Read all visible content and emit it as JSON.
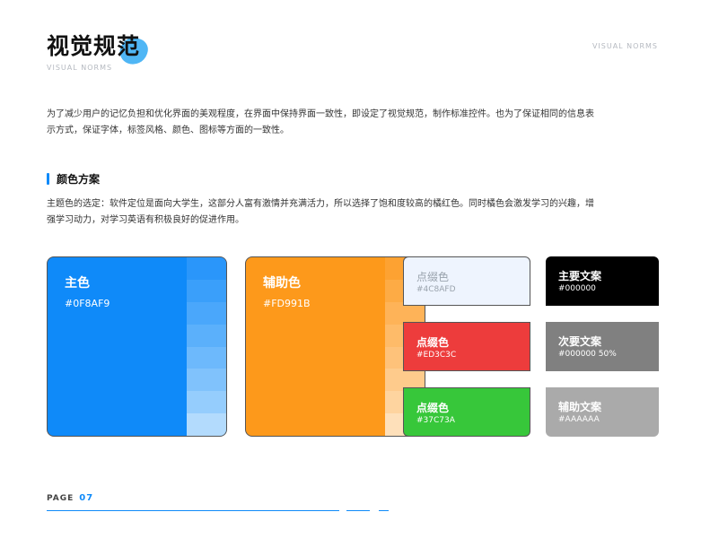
{
  "header": {
    "title": "视觉规范",
    "subtitle": "VISUAL NORMS",
    "corner": "VISUAL NORMS"
  },
  "intro": "为了减少用户的记忆负担和优化界面的美观程度，在界面中保持界面一致性，即设定了视觉规范，制作标准控件。也为了保证相同的信息表示方式，保证字体，标签风格、颜色、图标等方面的一致性。",
  "section": {
    "title": "颜色方案",
    "description": "主题色的选定：软件定位是面向大学生，这部分人富有激情并充满活力，所以选择了饱和度较高的橘红色。同时橘色会激发学习的兴趣，增强学习动力，对学习英语有积极良好的促进作用。"
  },
  "colors": {
    "primary": {
      "name": "主色",
      "hex": "#0F8AF9",
      "color": "#0F8AF9"
    },
    "secondary": {
      "name": "辅助色",
      "hex": "#FD991B",
      "color": "#FD991B"
    },
    "accent1": {
      "name": "点缀色",
      "hex": "#4C8AFD",
      "color": "#EEF4FE",
      "text_color": "#9aa3ad"
    },
    "accent2": {
      "name": "点缀色",
      "hex": "#ED3C3C",
      "color": "#ED3C3C"
    },
    "accent3": {
      "name": "点缀色",
      "hex": "#37C73A",
      "color": "#37C73A"
    },
    "text_primary": {
      "name": "主要文案",
      "hex": "#000000",
      "color": "#000000"
    },
    "text_secondary": {
      "name": "次要文案",
      "hex": "#000000  50%",
      "color": "#808080"
    },
    "text_aux": {
      "name": "辅助文案",
      "hex": "#AAAAAA",
      "color": "#AAAAAA"
    }
  },
  "primary_tints": [
    "#2a96fa",
    "#3a9ffa",
    "#4aa7fb",
    "#5bb0fb",
    "#6db9fc",
    "#80c2fc",
    "#95cdfd",
    "#b3dbfd"
  ],
  "secondary_tints": [
    "#fda232",
    "#fdab45",
    "#feb358",
    "#febb69",
    "#fec27a",
    "#fecb8c",
    "#fed49f",
    "#fee0ba"
  ],
  "footer": {
    "label": "PAGE",
    "number": "07"
  }
}
